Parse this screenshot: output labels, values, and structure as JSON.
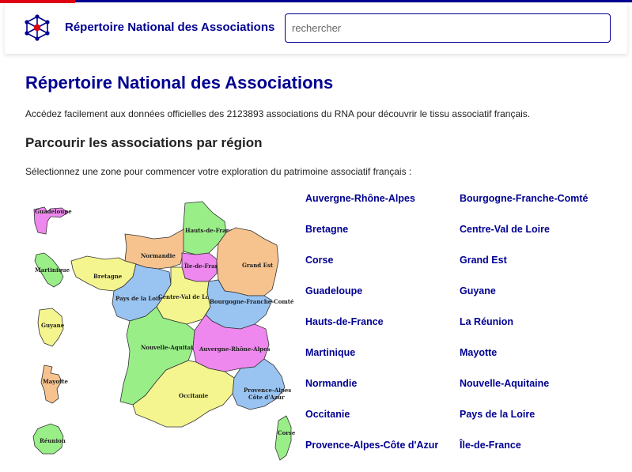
{
  "header": {
    "title": "Répertoire National des Associations",
    "search_placeholder": "rechercher",
    "logo_icon": "network-logo-icon"
  },
  "main": {
    "title": "Répertoire National des Associations",
    "intro": "Accédez facilement aux données officielles des 2123893 associations du RNA pour découvrir le tissu associatif français.",
    "section_title": "Parcourir les associations par région",
    "prompt": "Sélectionnez une zone pour commencer votre exploration du patrimoine associatif français :"
  },
  "map_labels": {
    "guadeloupe": "Guadeloupe",
    "martinique": "Martinique",
    "guyane": "Guyane",
    "mayotte": "Mayotte",
    "reunion": "Réunion",
    "hauts_de_france": "Hauts-de-France",
    "normandie": "Normandie",
    "ile_de_france": "Île-de-France",
    "grand_est": "Grand Est",
    "bretagne": "Bretagne",
    "pays_de_la_loire": "Pays de la Loire",
    "centre_val_de_loire": "Centre-Val de Loire",
    "bourgogne_franche_comte": "Bourgogne-Franche-Comté",
    "nouvelle_aquitaine": "Nouvelle-Aquitaine",
    "auvergne_rhone_alpes": "Auvergne-Rhône-Alpes",
    "occitanie": "Occitanie",
    "paca_line1": "Provence-Alpes",
    "paca_line2": "Côte d'Azur",
    "corse": "Corse"
  },
  "region_colors": {
    "green": "#99ee88",
    "orange": "#f6c38f",
    "pink": "#ee88ee",
    "yellow": "#f5f58f",
    "blue": "#99c4f2"
  },
  "regions": [
    "Auvergne-Rhône-Alpes",
    "Bourgogne-Franche-Comté",
    "Bretagne",
    "Centre-Val de Loire",
    "Corse",
    "Grand Est",
    "Guadeloupe",
    "Guyane",
    "Hauts-de-France",
    "La Réunion",
    "Martinique",
    "Mayotte",
    "Normandie",
    "Nouvelle-Aquitaine",
    "Occitanie",
    "Pays de la Loire",
    "Provence-Alpes-Côte d'Azur",
    "Île-de-France"
  ]
}
